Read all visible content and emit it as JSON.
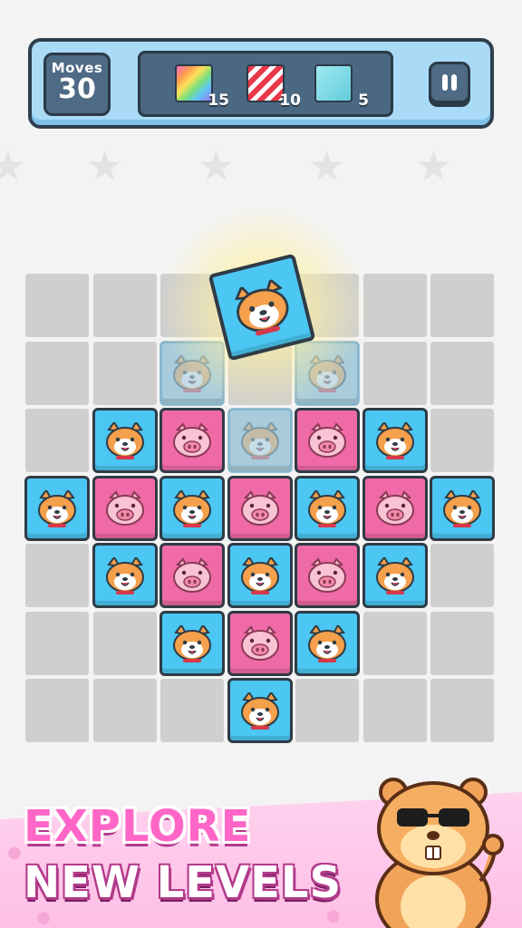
{
  "hud": {
    "moves_label": "Moves",
    "moves_value": "30",
    "goals": [
      {
        "icon": "rainbow-tile-icon",
        "count": "15"
      },
      {
        "icon": "striped-tile-icon",
        "count": "10"
      },
      {
        "icon": "glass-tile-icon",
        "count": "5"
      }
    ],
    "pause_icon": "pause-icon"
  },
  "board": {
    "cols": 7,
    "rows": 7,
    "pieces": [
      [
        "empty",
        "empty",
        "empty",
        "empty",
        "empty",
        "empty",
        "empty"
      ],
      [
        "empty",
        "empty",
        "ghost",
        "empty",
        "ghost",
        "empty",
        "empty"
      ],
      [
        "empty",
        "dog",
        "pig",
        "ghost",
        "pig",
        "dog",
        "empty"
      ],
      [
        "dog",
        "pig",
        "dog",
        "pig",
        "dog",
        "pig",
        "dog"
      ],
      [
        "empty",
        "dog",
        "pig",
        "dog",
        "pig",
        "dog",
        "empty"
      ],
      [
        "empty",
        "empty",
        "dog",
        "pig",
        "dog",
        "empty",
        "empty"
      ],
      [
        "empty",
        "empty",
        "empty",
        "dog",
        "empty",
        "empty",
        "empty"
      ]
    ],
    "flying_piece": "dog"
  },
  "colors": {
    "dog_tile": "#4cc6f2",
    "pig_tile": "#ef6aa6",
    "empty_cell": "#cfcfcf",
    "hud_panel": "#a9dbf7",
    "banner": "#ffc6ea"
  },
  "banner": {
    "line1": "EXPLORE",
    "line2": "NEW LEVELS",
    "mascot": "hamster-with-sunglasses-icon"
  }
}
